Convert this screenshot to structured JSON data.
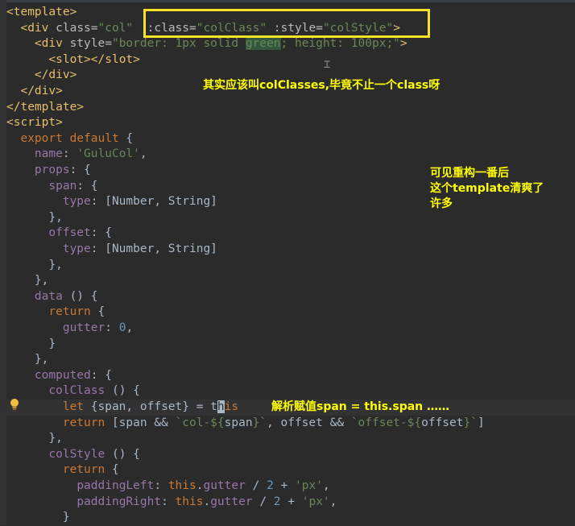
{
  "editor": {
    "lines": [
      [
        {
          "t": "<template>",
          "c": "t-tag"
        }
      ],
      [
        {
          "t": "  "
        },
        {
          "t": "<div ",
          "c": "t-tag"
        },
        {
          "t": "class=",
          "c": "t-attr"
        },
        {
          "t": "\"col\"",
          "c": "t-str"
        },
        {
          "t": "  "
        },
        {
          "t": ":class=",
          "c": "t-attr"
        },
        {
          "t": "\"colClass\"",
          "c": "t-str"
        },
        {
          "t": " "
        },
        {
          "t": ":style=",
          "c": "t-attr"
        },
        {
          "t": "\"colStyle\"",
          "c": "t-str"
        },
        {
          "t": ">",
          "c": "t-tag"
        }
      ],
      [
        {
          "t": "    "
        },
        {
          "t": "<div ",
          "c": "t-tag"
        },
        {
          "t": "style=",
          "c": "t-attr"
        },
        {
          "t": "\"border: 1px solid ",
          "c": "t-str"
        },
        {
          "t": "green",
          "c": "t-green-word"
        },
        {
          "t": "; height: 100px;\"",
          "c": "t-str"
        },
        {
          "t": ">",
          "c": "t-tag"
        }
      ],
      [
        {
          "t": "      "
        },
        {
          "t": "<slot></slot>",
          "c": "t-tag"
        }
      ],
      [
        {
          "t": "    "
        },
        {
          "t": "</div>",
          "c": "t-tag"
        }
      ],
      [
        {
          "t": "  "
        },
        {
          "t": "</div>",
          "c": "t-tag"
        }
      ],
      [
        {
          "t": "</template>",
          "c": "t-tag"
        }
      ],
      [
        {
          "t": "<script>",
          "c": "t-tag"
        }
      ],
      [
        {
          "t": "  "
        },
        {
          "t": "export default ",
          "c": "t-kw"
        },
        {
          "t": "{"
        }
      ],
      [
        {
          "t": "    "
        },
        {
          "t": "name",
          "c": "t-prop"
        },
        {
          "t": ": "
        },
        {
          "t": "'GuluCol'",
          "c": "t-str"
        },
        {
          "t": ","
        }
      ],
      [
        {
          "t": "    "
        },
        {
          "t": "props",
          "c": "t-prop"
        },
        {
          "t": ": {"
        }
      ],
      [
        {
          "t": "      "
        },
        {
          "t": "span",
          "c": "t-prop"
        },
        {
          "t": ": {"
        }
      ],
      [
        {
          "t": "        "
        },
        {
          "t": "type",
          "c": "t-prop"
        },
        {
          "t": ": [Number, String]"
        }
      ],
      [
        {
          "t": "      },"
        }
      ],
      [
        {
          "t": "      "
        },
        {
          "t": "offset",
          "c": "t-prop"
        },
        {
          "t": ": {"
        }
      ],
      [
        {
          "t": "        "
        },
        {
          "t": "type",
          "c": "t-prop"
        },
        {
          "t": ": [Number, String]"
        }
      ],
      [
        {
          "t": "      },"
        }
      ],
      [
        {
          "t": "    },"
        }
      ],
      [
        {
          "t": "    "
        },
        {
          "t": "data ",
          "c": "t-prop"
        },
        {
          "t": "() {"
        }
      ],
      [
        {
          "t": "      "
        },
        {
          "t": "return ",
          "c": "t-kw"
        },
        {
          "t": "{"
        }
      ],
      [
        {
          "t": "        "
        },
        {
          "t": "gutter",
          "c": "t-prop"
        },
        {
          "t": ": "
        },
        {
          "t": "0",
          "c": "t-num"
        },
        {
          "t": ","
        }
      ],
      [
        {
          "t": "      }"
        }
      ],
      [
        {
          "t": "    },"
        }
      ],
      [
        {
          "t": "    "
        },
        {
          "t": "computed",
          "c": "t-prop"
        },
        {
          "t": ": {"
        }
      ],
      [
        {
          "t": "      "
        },
        {
          "t": "colClass ",
          "c": "t-prop"
        },
        {
          "t": "() {"
        }
      ],
      [
        {
          "t": "        "
        },
        {
          "t": "let ",
          "c": "t-kw"
        },
        {
          "t": "{span, offset} = t"
        },
        {
          "t": "h",
          "c": "t-caret"
        },
        {
          "t": "is",
          "c": "t-kw"
        }
      ],
      [
        {
          "t": "        "
        },
        {
          "t": "return ",
          "c": "t-kw"
        },
        {
          "t": "[span && "
        },
        {
          "t": "`col-${",
          "c": "t-str"
        },
        {
          "t": "span"
        },
        {
          "t": "}`",
          "c": "t-str"
        },
        {
          "t": ", offset && "
        },
        {
          "t": "`offset-${",
          "c": "t-str"
        },
        {
          "t": "offset"
        },
        {
          "t": "}`",
          "c": "t-str"
        },
        {
          "t": "]"
        }
      ],
      [
        {
          "t": "      },"
        }
      ],
      [
        {
          "t": "      "
        },
        {
          "t": "colStyle ",
          "c": "t-prop"
        },
        {
          "t": "() {"
        }
      ],
      [
        {
          "t": "        "
        },
        {
          "t": "return ",
          "c": "t-kw"
        },
        {
          "t": "{"
        }
      ],
      [
        {
          "t": "          "
        },
        {
          "t": "paddingLeft",
          "c": "t-prop"
        },
        {
          "t": ": "
        },
        {
          "t": "this",
          "c": "t-kw"
        },
        {
          "t": "."
        },
        {
          "t": "gutter",
          "c": "t-prop"
        },
        {
          "t": " / "
        },
        {
          "t": "2",
          "c": "t-num"
        },
        {
          "t": " + "
        },
        {
          "t": "'px'",
          "c": "t-str"
        },
        {
          "t": ","
        }
      ],
      [
        {
          "t": "          "
        },
        {
          "t": "paddingRight",
          "c": "t-prop"
        },
        {
          "t": ": "
        },
        {
          "t": "this",
          "c": "t-kw"
        },
        {
          "t": "."
        },
        {
          "t": "gutter",
          "c": "t-prop"
        },
        {
          "t": " / "
        },
        {
          "t": "2",
          "c": "t-num"
        },
        {
          "t": " + "
        },
        {
          "t": "'px'",
          "c": "t-str"
        },
        {
          "t": ","
        }
      ],
      [
        {
          "t": "        }"
        }
      ]
    ],
    "current_line": 25
  },
  "annotations": {
    "note1": "其实应该叫colClasses,毕竟不止一个class呀",
    "note2": "可见重构一番后\n这个template清爽了\n许多",
    "note3": "解析赋值span = this.span ……"
  },
  "colors": {
    "highlight_box": "#f5e32a",
    "annotation_text": "#ffff00",
    "background": "#2b2b2b"
  }
}
